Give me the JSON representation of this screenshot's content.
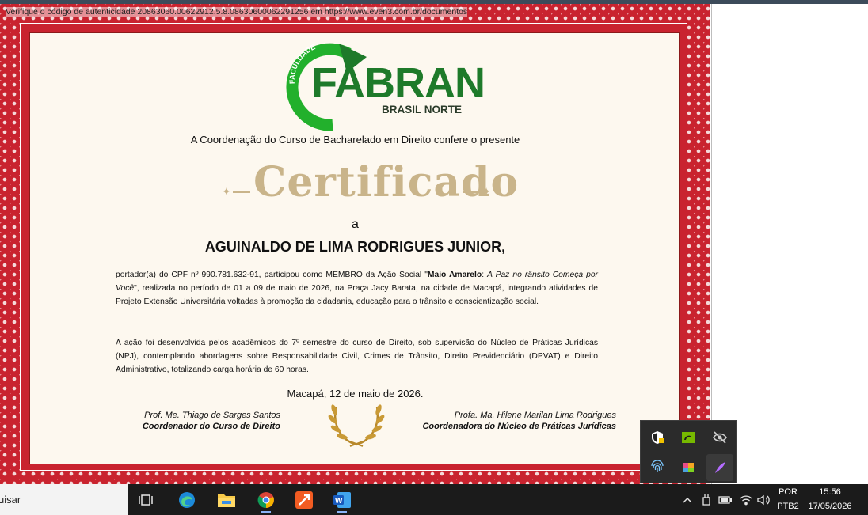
{
  "certificate": {
    "verify_text": "Verifique o código de autenticidade 20863060.00622912.5.8.08630600062291256 em https://www.even3.com.br/documentos",
    "logo": {
      "arc_text": "FACULDADE",
      "name": "FABRAN",
      "subtitle": "BRASIL NORTE"
    },
    "intro": "A Coordenação do Curso de Bacharelado em Direito confere o presente",
    "title": "Certificado",
    "a_word": "a",
    "recipient": "AGUINALDO DE LIMA RODRIGUES JUNIOR,",
    "paragraph1": {
      "part1": "portador(a) do CPF nº 990.781.632-91, participou como MEMBRO da Ação Social \"",
      "bold": "Maio Amarelo",
      "colon": ": ",
      "italic": "A Paz no rânsito Começa por Você",
      "part2": "\", realizada no período de 01 a 09 de maio de 2026, na Praça Jacy Barata, na cidade de Macapá, integrando atividades de Projeto Extensão Universitária voltadas à promoção da cidadania, educação para o trânsito e conscientização social."
    },
    "paragraph2": "A ação foi desenvolvida pelos acadêmicos do 7º semestre do curso de Direito, sob supervisão do Núcleo de Práticas Jurídicas (NPJ), contemplando abordagens sobre Responsabilidade Civil, Crimes de Trânsito, Direito Previdenciário (DPVAT) e Direito Administrativo, totalizando carga horária de 60 horas.",
    "date": "Macapá, 12 de maio de 2026.",
    "signatures": [
      {
        "name": "Prof. Me. Thiago de Sarges Santos",
        "role": "Coordenador do Curso de Direito"
      },
      {
        "name": "Profa. Ma. Hilene Marilan Lima Rodrigues",
        "role": "Coordenadora do Núcleo de Práticas Jurídicas"
      }
    ],
    "colors": {
      "border_red": "#c9232f",
      "paper": "#fdf8ef",
      "gold": "#c9b48a",
      "logo_green": "#1e7a2a"
    }
  },
  "tray_flyout": {
    "icons": [
      "security-shield-icon",
      "nvidia-icon",
      "hidden-eye-icon",
      "fingerprint-icon",
      "color-app-icon",
      "feather-pen-icon"
    ]
  },
  "taskbar": {
    "search_text": "uisar",
    "apps": [
      "task-view-icon",
      "edge-icon",
      "file-explorer-icon",
      "chrome-icon",
      "tool-app-icon",
      "word-icon"
    ],
    "tray": {
      "language": "POR",
      "layout": "PTB2",
      "time": "15:56",
      "date": "17/05/2026"
    }
  }
}
